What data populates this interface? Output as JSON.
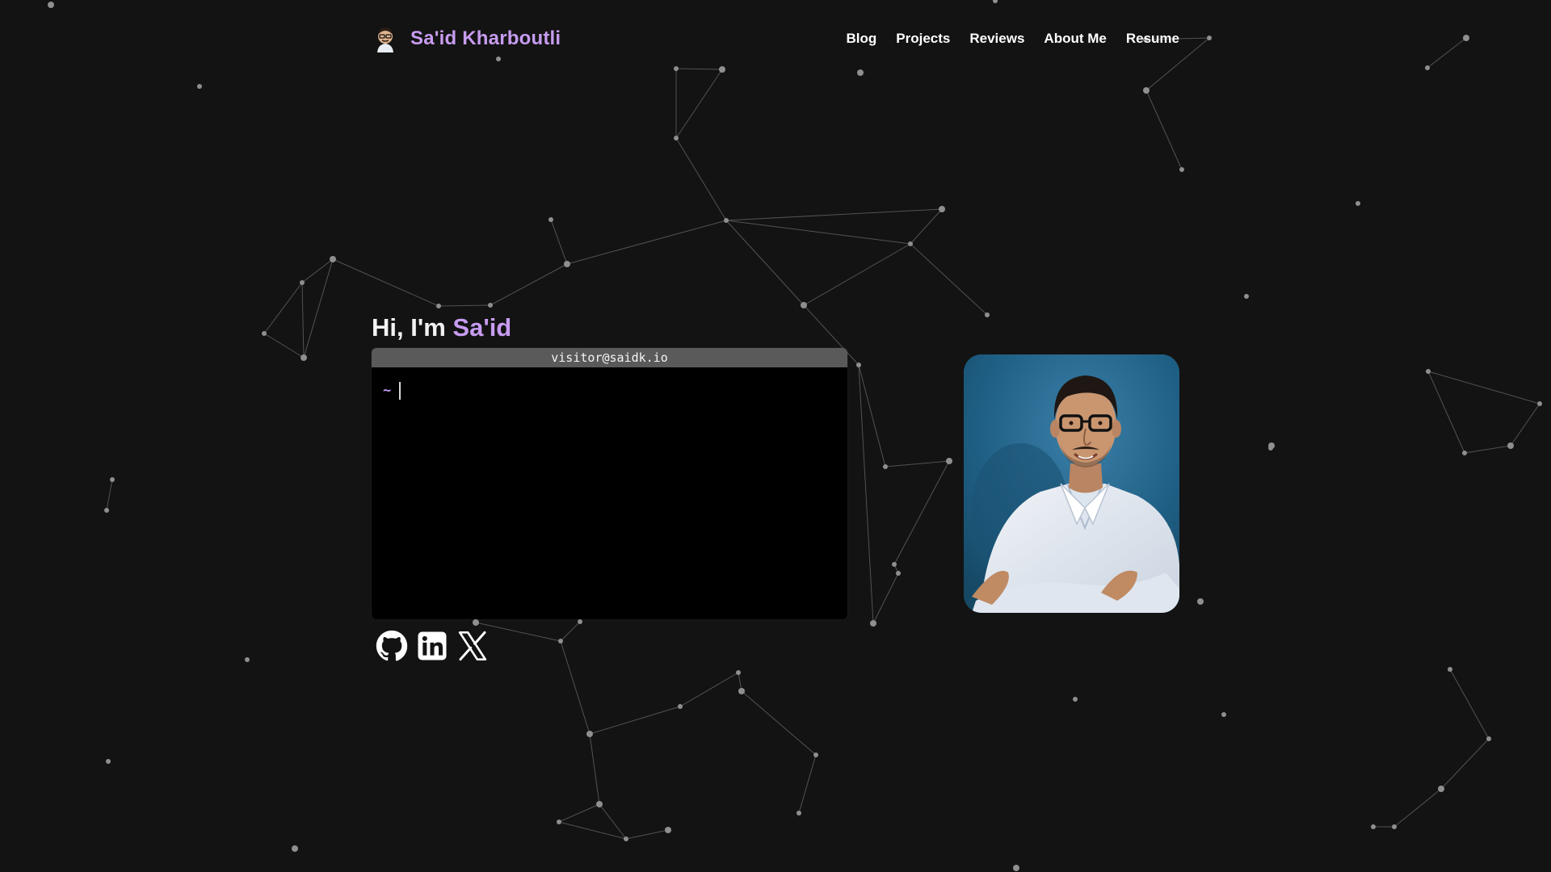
{
  "header": {
    "name": "Sa'id Kharboutli",
    "avatar_icon": "memoji-avatar-icon",
    "nav": [
      "Blog",
      "Projects",
      "Reviews",
      "About Me",
      "Resume"
    ]
  },
  "hero": {
    "greeting": "Hi, I'm",
    "name": "Sa'id"
  },
  "terminal": {
    "title": "visitor@saidk.io",
    "prompt": "~",
    "input_value": ""
  },
  "social": {
    "icons": [
      "github-icon",
      "linkedin-icon",
      "x-icon"
    ]
  },
  "colors": {
    "background": "#131313",
    "accent": "#c79cf0",
    "terminal_bar": "#5a5a5a",
    "terminal_body": "#000000",
    "portrait_bg": "#1d5a7c"
  }
}
